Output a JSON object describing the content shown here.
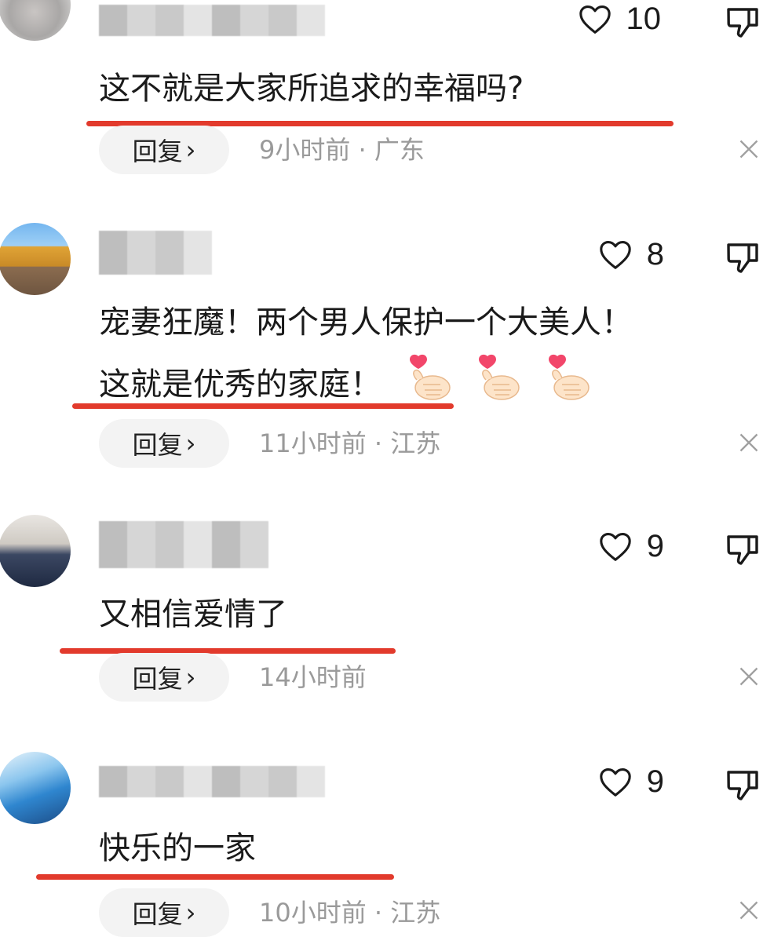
{
  "comments": [
    {
      "text": "这不就是大家所追求的幸福吗?",
      "likes": "10",
      "reply_label": "回复",
      "chevron": "›",
      "meta": "9小时前 · 广东"
    },
    {
      "text_line1": "宠妻狂魔！两个男人保护一个大美人！",
      "text_line2": "这就是优秀的家庭！",
      "likes": "8",
      "reply_label": "回复",
      "chevron": "›",
      "meta": "11小时前 · 江苏",
      "emojis": [
        "heart-hands-icon",
        "heart-hands-icon",
        "heart-hands-icon"
      ]
    },
    {
      "text": "又相信爱情了",
      "likes": "9",
      "reply_label": "回复",
      "chevron": "›",
      "meta": "14小时前"
    },
    {
      "text": "快乐的一家",
      "likes": "9",
      "reply_label": "回复",
      "chevron": "›",
      "meta": "10小时前 · 江苏"
    }
  ],
  "colors": {
    "underline": "#e23a2c",
    "meta_text": "#9a9a9a",
    "reply_bg": "#f3f3f3",
    "heart_emoji": "#f2466a"
  },
  "icons": {
    "like": "heart-outline-icon",
    "dislike": "thumbs-down-icon",
    "dismiss": "close-icon"
  }
}
